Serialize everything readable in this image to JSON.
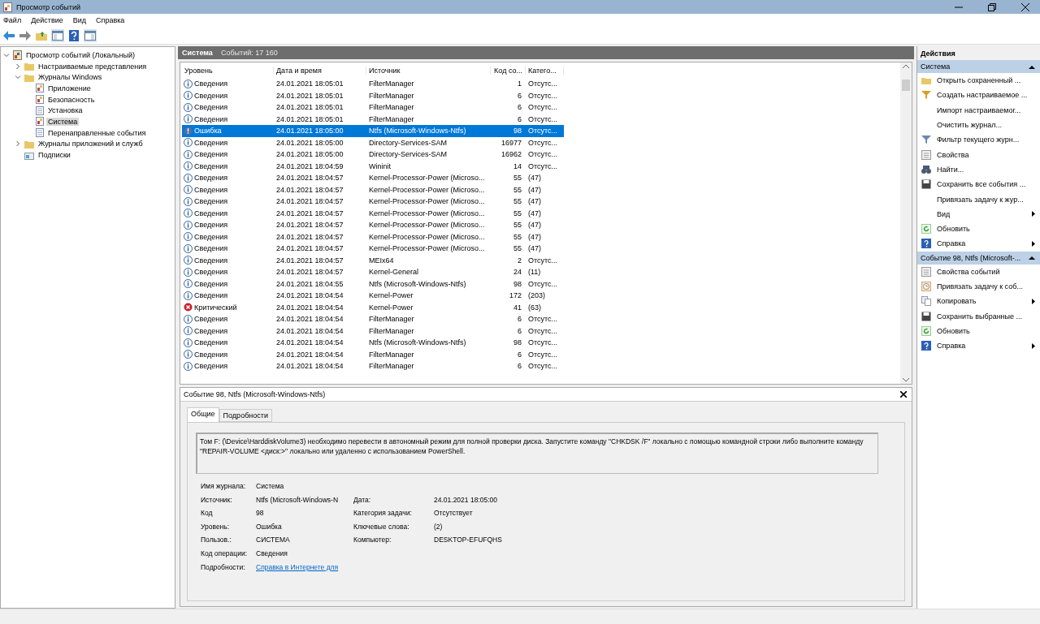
{
  "window": {
    "title": "Просмотр событий"
  },
  "menu": [
    "Файл",
    "Действие",
    "Вид",
    "Справка"
  ],
  "tree": [
    {
      "label": "Просмотр событий (Локальный)",
      "kind": "root",
      "expanded": true,
      "selected": false,
      "children": [
        {
          "label": "Настраиваемые представления",
          "kind": "folder",
          "expanded": false,
          "selected": false
        },
        {
          "label": "Журналы Windows",
          "kind": "folder",
          "expanded": true,
          "selected": false,
          "children": [
            {
              "label": "Приложение",
              "kind": "log",
              "selected": false
            },
            {
              "label": "Безопасность",
              "kind": "log",
              "selected": false
            },
            {
              "label": "Установка",
              "kind": "plain",
              "selected": false
            },
            {
              "label": "Система",
              "kind": "log",
              "selected": true
            },
            {
              "label": "Перенаправленные события",
              "kind": "plain",
              "selected": false
            }
          ]
        },
        {
          "label": "Журналы приложений и служб",
          "kind": "folder",
          "expanded": false,
          "selected": false
        },
        {
          "label": "Подписки",
          "kind": "subs",
          "selected": false
        }
      ]
    }
  ],
  "log_header": {
    "title": "Система",
    "count": "Событий: 17 160"
  },
  "table": {
    "columns": [
      "Уровень",
      "Дата и время",
      "Источник",
      "Код со...",
      "Катего..."
    ],
    "rows": [
      {
        "kind": "info",
        "level": "Сведения",
        "date": "24.01.2021 18:05:01",
        "source": "FilterManager",
        "code": "1",
        "category": "Отсутс...",
        "selected": false
      },
      {
        "kind": "info",
        "level": "Сведения",
        "date": "24.01.2021 18:05:01",
        "source": "FilterManager",
        "code": "6",
        "category": "Отсутс...",
        "selected": false
      },
      {
        "kind": "info",
        "level": "Сведения",
        "date": "24.01.2021 18:05:01",
        "source": "FilterManager",
        "code": "6",
        "category": "Отсутс...",
        "selected": false
      },
      {
        "kind": "info",
        "level": "Сведения",
        "date": "24.01.2021 18:05:01",
        "source": "FilterManager",
        "code": "6",
        "category": "Отсутс...",
        "selected": false
      },
      {
        "kind": "error",
        "level": "Ошибка",
        "date": "24.01.2021 18:05:00",
        "source": "Ntfs (Microsoft-Windows-Ntfs)",
        "code": "98",
        "category": "Отсутс...",
        "selected": true
      },
      {
        "kind": "info",
        "level": "Сведения",
        "date": "24.01.2021 18:05:00",
        "source": "Directory-Services-SAM",
        "code": "16977",
        "category": "Отсутс...",
        "selected": false
      },
      {
        "kind": "info",
        "level": "Сведения",
        "date": "24.01.2021 18:05:00",
        "source": "Directory-Services-SAM",
        "code": "16962",
        "category": "Отсутс...",
        "selected": false
      },
      {
        "kind": "info",
        "level": "Сведения",
        "date": "24.01.2021 18:04:59",
        "source": "Wininit",
        "code": "14",
        "category": "Отсутс...",
        "selected": false
      },
      {
        "kind": "info",
        "level": "Сведения",
        "date": "24.01.2021 18:04:57",
        "source": "Kernel-Processor-Power (Microso...",
        "code": "55",
        "category": "(47)",
        "selected": false
      },
      {
        "kind": "info",
        "level": "Сведения",
        "date": "24.01.2021 18:04:57",
        "source": "Kernel-Processor-Power (Microso...",
        "code": "55",
        "category": "(47)",
        "selected": false
      },
      {
        "kind": "info",
        "level": "Сведения",
        "date": "24.01.2021 18:04:57",
        "source": "Kernel-Processor-Power (Microso...",
        "code": "55",
        "category": "(47)",
        "selected": false
      },
      {
        "kind": "info",
        "level": "Сведения",
        "date": "24.01.2021 18:04:57",
        "source": "Kernel-Processor-Power (Microso...",
        "code": "55",
        "category": "(47)",
        "selected": false
      },
      {
        "kind": "info",
        "level": "Сведения",
        "date": "24.01.2021 18:04:57",
        "source": "Kernel-Processor-Power (Microso...",
        "code": "55",
        "category": "(47)",
        "selected": false
      },
      {
        "kind": "info",
        "level": "Сведения",
        "date": "24.01.2021 18:04:57",
        "source": "Kernel-Processor-Power (Microso...",
        "code": "55",
        "category": "(47)",
        "selected": false
      },
      {
        "kind": "info",
        "level": "Сведения",
        "date": "24.01.2021 18:04:57",
        "source": "Kernel-Processor-Power (Microso...",
        "code": "55",
        "category": "(47)",
        "selected": false
      },
      {
        "kind": "info",
        "level": "Сведения",
        "date": "24.01.2021 18:04:57",
        "source": "MEIx64",
        "code": "2",
        "category": "Отсутс...",
        "selected": false
      },
      {
        "kind": "info",
        "level": "Сведения",
        "date": "24.01.2021 18:04:57",
        "source": "Kernel-General",
        "code": "24",
        "category": "(11)",
        "selected": false
      },
      {
        "kind": "info",
        "level": "Сведения",
        "date": "24.01.2021 18:04:55",
        "source": "Ntfs (Microsoft-Windows-Ntfs)",
        "code": "98",
        "category": "Отсутс...",
        "selected": false
      },
      {
        "kind": "info",
        "level": "Сведения",
        "date": "24.01.2021 18:04:54",
        "source": "Kernel-Power",
        "code": "172",
        "category": "(203)",
        "selected": false
      },
      {
        "kind": "critical",
        "level": "Критический",
        "date": "24.01.2021 18:04:54",
        "source": "Kernel-Power",
        "code": "41",
        "category": "(63)",
        "selected": false
      },
      {
        "kind": "info",
        "level": "Сведения",
        "date": "24.01.2021 18:04:54",
        "source": "FilterManager",
        "code": "6",
        "category": "Отсутс...",
        "selected": false
      },
      {
        "kind": "info",
        "level": "Сведения",
        "date": "24.01.2021 18:04:54",
        "source": "FilterManager",
        "code": "6",
        "category": "Отсутс...",
        "selected": false
      },
      {
        "kind": "info",
        "level": "Сведения",
        "date": "24.01.2021 18:04:54",
        "source": "Ntfs (Microsoft-Windows-Ntfs)",
        "code": "98",
        "category": "Отсутс...",
        "selected": false
      },
      {
        "kind": "info",
        "level": "Сведения",
        "date": "24.01.2021 18:04:54",
        "source": "FilterManager",
        "code": "6",
        "category": "Отсутс...",
        "selected": false
      },
      {
        "kind": "info",
        "level": "Сведения",
        "date": "24.01.2021 18:04:54",
        "source": "FilterManager",
        "code": "6",
        "category": "Отсутс...",
        "selected": false
      }
    ]
  },
  "details": {
    "title": "Событие 98, Ntfs (Microsoft-Windows-Ntfs)",
    "tabs": [
      {
        "label": "Общие",
        "selected": true
      },
      {
        "label": "Подробности",
        "selected": false
      }
    ],
    "message": "Том F: (\\Device\\HarddiskVolume3) необходимо перевести в автономный режим для полной проверки диска.  Запустите команду \"CHKDSK /F\" локально с помощью командной строки либо выполните команду \"REPAIR-VOLUME <диск:>\" локально или удаленно с использованием PowerShell.",
    "fields": [
      {
        "label": "Имя журнала:",
        "value": "Система"
      },
      {
        "label": "Источник:",
        "value": "Ntfs (Microsoft-Windows-N",
        "label2": "Дата:",
        "value2": "24.01.2021 18:05:00"
      },
      {
        "label": "Код",
        "value": "98",
        "label2": "Категория задачи:",
        "value2": "Отсутствует"
      },
      {
        "label": "Уровень:",
        "value": "Ошибка",
        "label2": "Ключевые слова:",
        "value2": "(2)"
      },
      {
        "label": "Пользов.:",
        "value": "СИСТЕМА",
        "label2": "Компьютер:",
        "value2": "DESKTOP-EFUFQHS"
      },
      {
        "label": "Код операции:",
        "value": "Сведения"
      },
      {
        "label": "Подробности:",
        "link": "Справка в Интернете для"
      }
    ]
  },
  "actions": {
    "title": "Действия",
    "sections": [
      {
        "title": "Система",
        "items": [
          {
            "label": "Открыть сохраненный ...",
            "kind": "open",
            "submenu": false
          },
          {
            "label": "Создать настраиваемое ...",
            "kind": "funnel",
            "submenu": false
          },
          {
            "label": "Импорт настраиваемог...",
            "kind": "none",
            "submenu": false
          },
          {
            "label": "Очистить журнал...",
            "kind": "none",
            "submenu": false
          },
          {
            "label": "Фильтр текущего журн...",
            "kind": "funnel2",
            "submenu": false
          },
          {
            "label": "Свойства",
            "kind": "props",
            "submenu": false
          },
          {
            "label": "Найти...",
            "kind": "find",
            "submenu": false
          },
          {
            "label": "Сохранить все события ...",
            "kind": "save",
            "submenu": false
          },
          {
            "label": "Привязать задачу к жур...",
            "kind": "none",
            "submenu": false
          },
          {
            "label": "Вид",
            "kind": "none",
            "submenu": true
          },
          {
            "label": "Обновить",
            "kind": "refresh",
            "submenu": false
          },
          {
            "label": "Справка",
            "kind": "help",
            "submenu": true
          }
        ]
      },
      {
        "title": "Событие 98, Ntfs (Microsoft-...",
        "items": [
          {
            "label": "Свойства событий",
            "kind": "props",
            "submenu": false
          },
          {
            "label": "Привязать задачу к соб...",
            "kind": "task",
            "submenu": false
          },
          {
            "label": "Копировать",
            "kind": "copy",
            "submenu": true
          },
          {
            "label": "Сохранить выбранные ...",
            "kind": "save",
            "submenu": false
          },
          {
            "label": "Обновить",
            "kind": "refresh",
            "submenu": false
          },
          {
            "label": "Справка",
            "kind": "help",
            "submenu": true
          }
        ]
      }
    ]
  }
}
